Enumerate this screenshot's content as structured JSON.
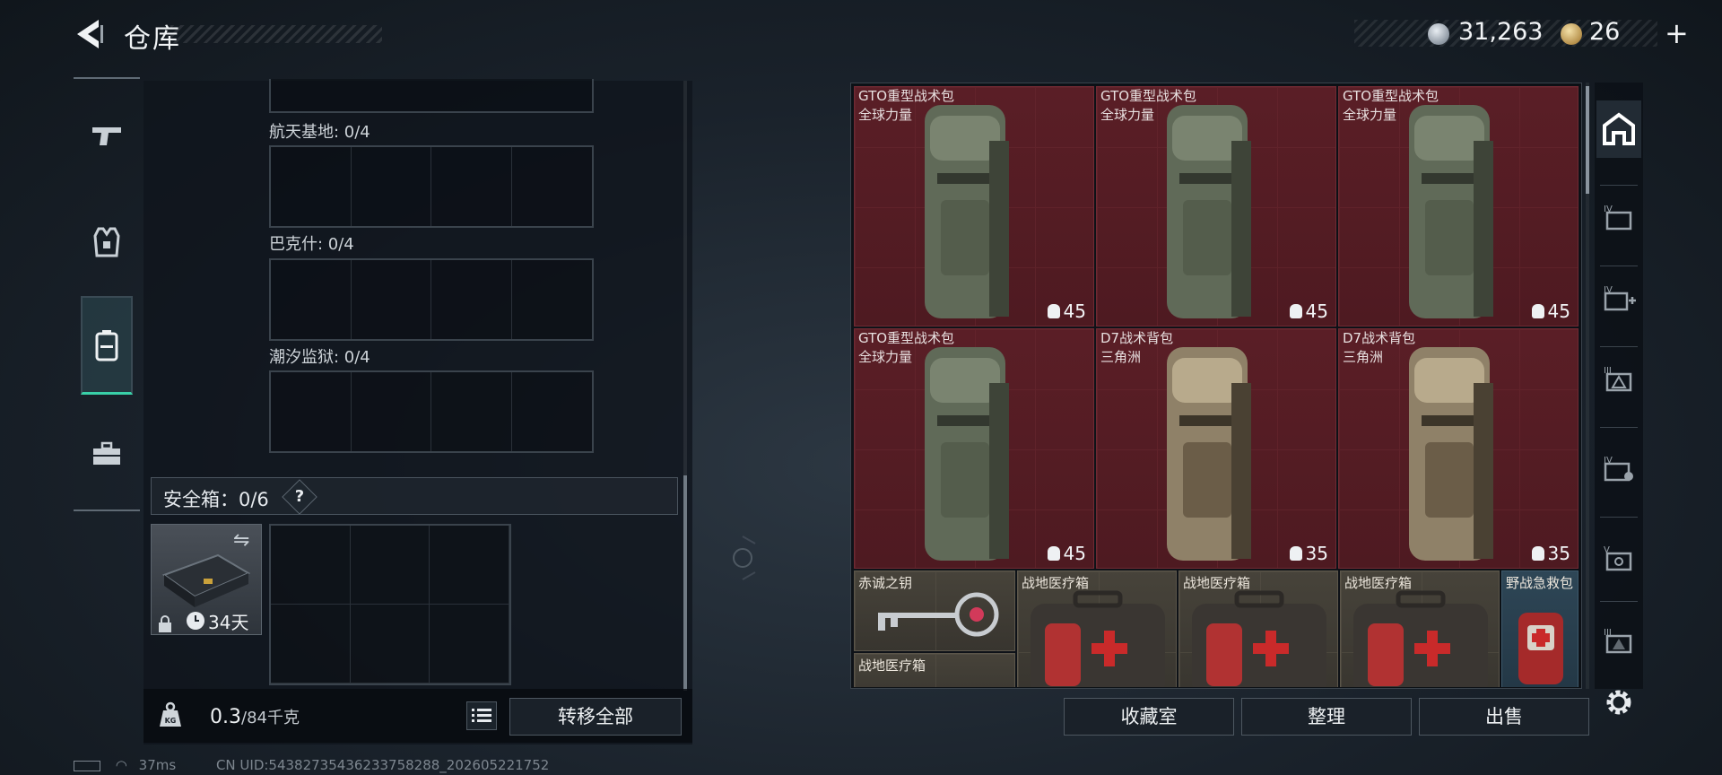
{
  "header": {
    "title": "仓库",
    "currency": {
      "silver": "31,263",
      "gold": "26",
      "plus": "+"
    }
  },
  "left_rail": {
    "items": [
      {
        "icon": "pistol-icon",
        "active": false
      },
      {
        "icon": "armor-vest-icon",
        "active": false
      },
      {
        "icon": "backpack-icon",
        "active": true
      },
      {
        "icon": "toolbox-icon",
        "active": false
      }
    ]
  },
  "map_slots": [
    {
      "label": "航天基地: 0/4"
    },
    {
      "label": "巴克什: 0/4"
    },
    {
      "label": "潮汐监狱: 0/4"
    }
  ],
  "safebox": {
    "label": "安全箱：0/6",
    "help": "?",
    "duration": "34天"
  },
  "weight": {
    "current": "0.3",
    "max": "/84千克"
  },
  "buttons": {
    "transfer_all": "转移全部",
    "collection": "收藏室",
    "organize": "整理",
    "sell": "出售"
  },
  "status": {
    "ping": "37ms",
    "uid": "CN UID:5438273543623375828​8_202605221752"
  },
  "items": [
    {
      "name": "GTO重型战术包",
      "brand": "全球力量",
      "capacity": "45",
      "color": "green"
    },
    {
      "name": "GTO重型战术包",
      "brand": "全球力量",
      "capacity": "45",
      "color": "green"
    },
    {
      "name": "GTO重型战术包",
      "brand": "全球力量",
      "capacity": "45",
      "color": "green"
    },
    {
      "name": "GTO重型战术包",
      "brand": "全球力量",
      "capacity": "45",
      "color": "green"
    },
    {
      "name": "D7战术背包",
      "brand": "三角洲",
      "capacity": "35",
      "color": "tan"
    },
    {
      "name": "D7战术背包",
      "brand": "三角洲",
      "capacity": "35",
      "color": "tan"
    }
  ],
  "small_items": [
    {
      "name": "赤诚之钥"
    },
    {
      "name": "战地医疗箱"
    },
    {
      "name": "战地医疗箱"
    },
    {
      "name": "战地医疗箱"
    },
    {
      "name": "野战急救包"
    },
    {
      "name": "战地医疗箱"
    }
  ],
  "right_tabs": [
    {
      "icon": "stash-home-icon",
      "active": true
    },
    {
      "icon": "container-iv-icon"
    },
    {
      "icon": "container-iv-plus-icon"
    },
    {
      "icon": "container-iii-triangle-icon"
    },
    {
      "icon": "container-iv-gear-icon"
    },
    {
      "icon": "container-v-icon"
    },
    {
      "icon": "container-iii-icon"
    }
  ],
  "colors": {
    "accent": "#39d0a8",
    "item_red": "#5a1e26",
    "item_gold": "#47433a",
    "item_blue": "#2e4656"
  }
}
